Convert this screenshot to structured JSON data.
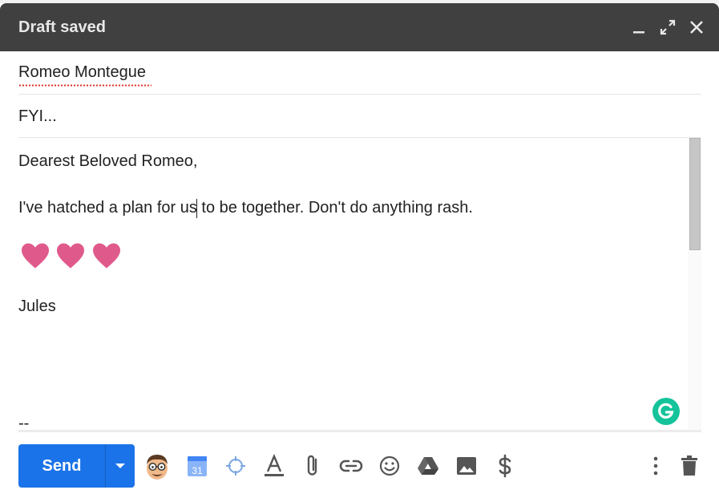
{
  "window": {
    "title": "Draft saved",
    "controls": {
      "minimize": "minimize-icon",
      "popout": "fullscreen-icon",
      "close": "close-icon"
    }
  },
  "fields": {
    "to": "Romeo Montegue",
    "subject": "FYI..."
  },
  "body": {
    "greeting": "Dearest Beloved Romeo,",
    "message": "I've hatched a plan for us to be together. Don't do anything rash.",
    "hearts": [
      "heart-icon",
      "heart-icon",
      "heart-icon"
    ],
    "signoff": "Jules",
    "signature_separator": "--"
  },
  "toolbar": {
    "send_label": "Send",
    "calendar_day": "31",
    "icons": [
      "avatar-bitmoji-icon",
      "calendar-icon",
      "crosshair-icon",
      "text-format-icon",
      "attach-icon",
      "link-icon",
      "emoji-icon",
      "drive-icon",
      "image-icon",
      "dollar-icon",
      "more-options-icon",
      "trash-icon"
    ]
  },
  "colors": {
    "title_bar": "#404040",
    "send_button": "#1a73e8",
    "heart": "#e0598b",
    "grammarly": "#15c39a",
    "spellcheck": "#d93025"
  }
}
